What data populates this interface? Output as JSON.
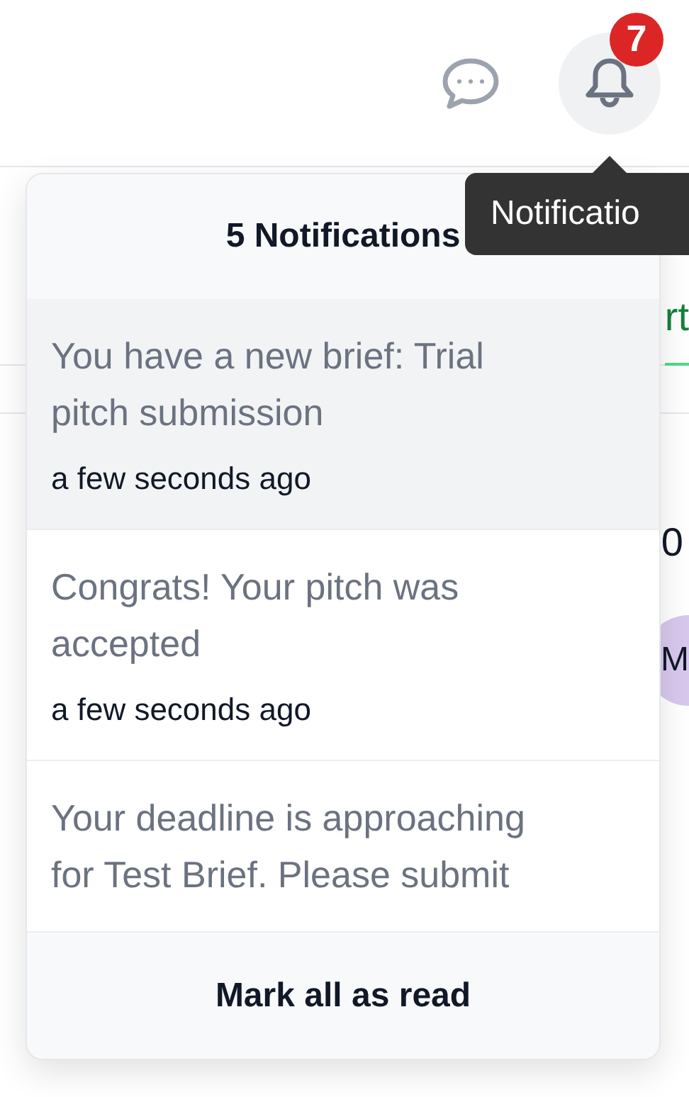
{
  "header": {
    "notifications_button": {
      "badge": "7",
      "selected": true
    }
  },
  "tooltip": {
    "text": "Notificatio"
  },
  "background": {
    "tab": {
      "label": "rt",
      "selected": true
    },
    "value": "0",
    "avatar": "M"
  },
  "notifications_panel": {
    "title": "5 Notifications",
    "items": [
      {
        "text": "You have a new brief: Trial pitch submission",
        "time": "a few seconds ago",
        "unread": true
      },
      {
        "text": "Congrats! Your pitch was accepted",
        "time": "a few seconds ago",
        "unread": false
      },
      {
        "text": "Your deadline is approaching for Test Brief. Please submit",
        "unread": false
      }
    ],
    "footer_button": "Mark all as read"
  }
}
